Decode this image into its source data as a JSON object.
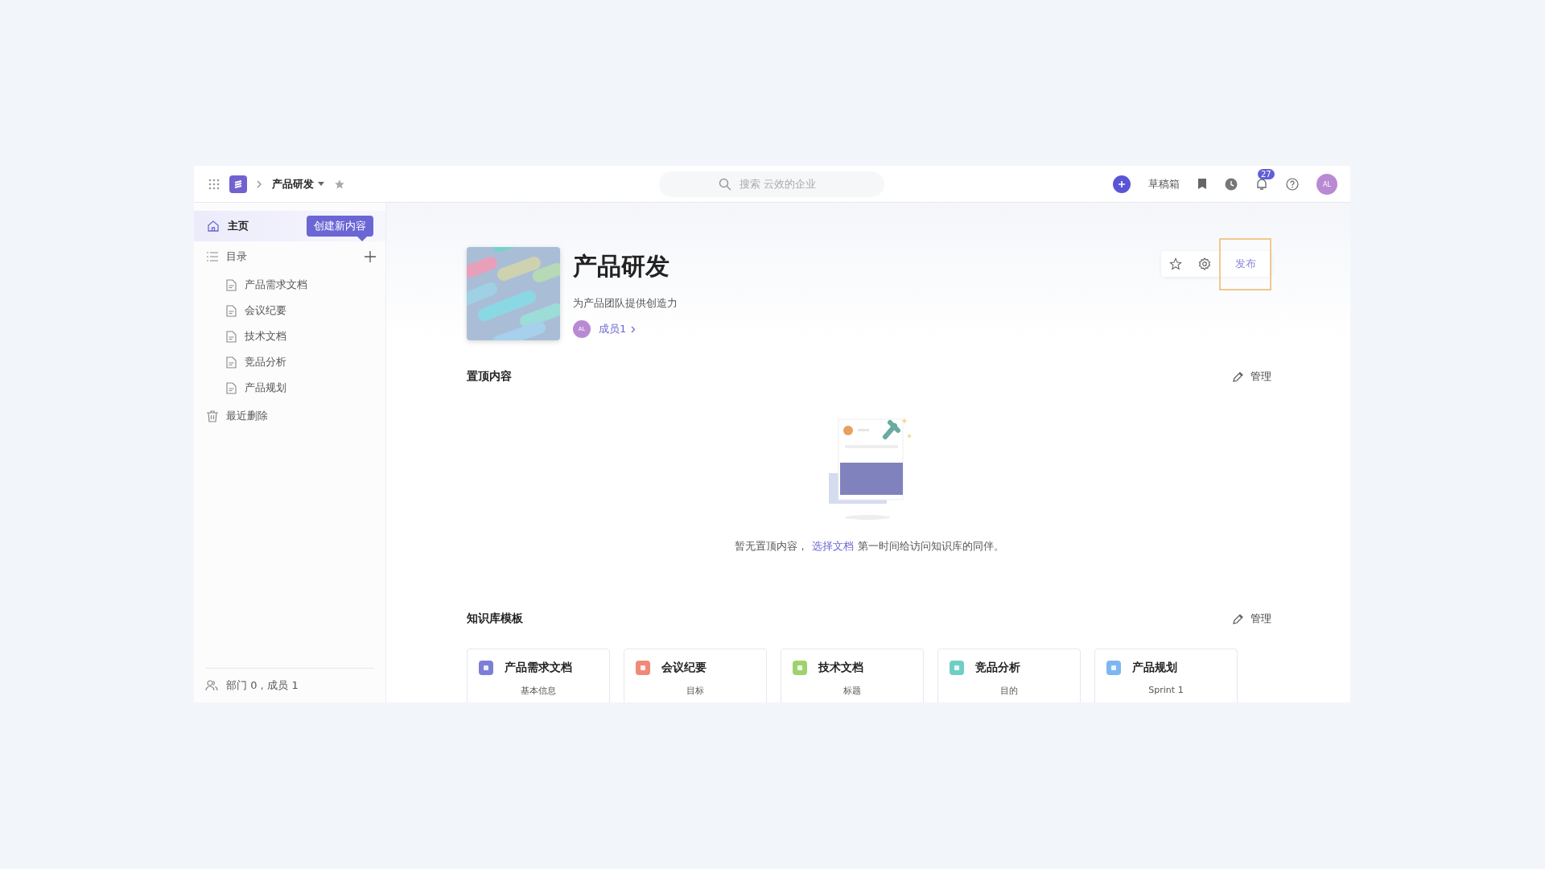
{
  "topbar": {
    "space": "产品研发",
    "search": {
      "placeholder": "搜索 云效的企业"
    },
    "drafts": "草稿箱",
    "notifications": "27",
    "avatar": "AL"
  },
  "sidebar": {
    "home": {
      "label": "主页",
      "selected": true
    },
    "tooltip": "创建新内容",
    "catalog": "目录",
    "docs": [
      {
        "label": "产品需求文档",
        "selected": false
      },
      {
        "label": "会议纪要",
        "selected": false
      },
      {
        "label": "技术文档",
        "selected": false
      },
      {
        "label": "竞品分析",
        "selected": false
      },
      {
        "label": "产品规划",
        "selected": false
      }
    ],
    "trash": "最近删除",
    "footer": "部门 0，成员 1"
  },
  "header": {
    "title": "产品研发",
    "description": "为产品团队提供创造力",
    "member_avatar": "AL",
    "members": "成员1",
    "publish": "发布"
  },
  "pinned": {
    "title": "置顶内容",
    "manage": "管理",
    "empty_before": "暂无置顶内容，",
    "empty_link": "选择文档",
    "empty_after": "第一时间给访问知识库的同伴。"
  },
  "templates": {
    "title": "知识库模板",
    "manage": "管理",
    "cards": [
      {
        "name": "产品需求文档",
        "subtitle": "基本信息",
        "color": "#7b7fd8"
      },
      {
        "name": "会议纪要",
        "subtitle": "目标",
        "color": "#ef8a78"
      },
      {
        "name": "技术文档",
        "subtitle": "标题",
        "color": "#9fd26f"
      },
      {
        "name": "竞品分析",
        "subtitle": "目的",
        "color": "#6fcfc6"
      },
      {
        "name": "产品规划",
        "subtitle": "Sprint 1",
        "color": "#7cb7f2"
      }
    ]
  }
}
